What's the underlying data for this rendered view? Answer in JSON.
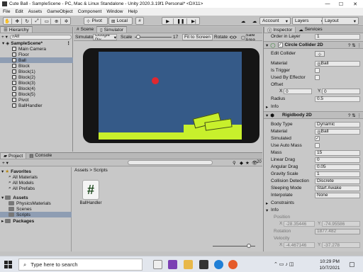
{
  "window": {
    "title": "Cute Ball - SampleScene - PC, Mac & Linux Standalone - Unity 2020.3.19f1 Personal* <DX11>",
    "min": "—",
    "max": "☐",
    "close": "✕"
  },
  "menu": [
    "File",
    "Edit",
    "Assets",
    "GameObject",
    "Component",
    "Window",
    "Help"
  ],
  "toolbar": {
    "pivot": "Pivot",
    "local": "Local",
    "account": "Account",
    "layers": "Layers",
    "layout": "Layout"
  },
  "hierarchy": {
    "tab": "Hierarchy",
    "search_placeholder": "All",
    "scene": "SampleScene*",
    "items": [
      "Main Camera",
      "Floor",
      "Ball",
      "Block",
      "Block(1)",
      "Block(2)",
      "Block(3)",
      "Block(4)",
      "Block(5)",
      "Pivot",
      "BallHandler"
    ],
    "selected": "Ball"
  },
  "scene_view": {
    "tab_scene": "Scene",
    "tab_sim": "Simulator",
    "device": "Simulator",
    "device_model": "Google Pix",
    "scale_label": "Scale",
    "scale_value": "17",
    "fit": "Fit to Screen",
    "rotate": "Rotate",
    "safe": "Safe Area"
  },
  "inspector": {
    "tab": "Inspector",
    "tab2": "Services",
    "order_label": "Order in Layer",
    "order_value": "1",
    "circle": {
      "title": "Circle Collider 2D",
      "edit": "Edit Collider",
      "material": "Material",
      "material_value": "Ball",
      "trigger": "Is Trigger",
      "effector": "Used By Effector",
      "offset": "Offset",
      "x": "0",
      "y": "0",
      "radius_label": "Radius",
      "radius": "0.5",
      "info": "Info"
    },
    "rb": {
      "title": "Rigidbody 2D",
      "bodytype": "Body Type",
      "bodytype_val": "Dynamic",
      "material": "Material",
      "material_val": "Ball",
      "simulated": "Simulated",
      "auto_mass": "Use Auto Mass",
      "mass": "Mass",
      "mass_val": "15",
      "linear": "Linear Drag",
      "linear_val": "0",
      "angular": "Angular Drag",
      "angular_val": "0.05",
      "gravity": "Gravity Scale",
      "gravity_val": "1",
      "collision": "Collision Detection",
      "collision_val": "Discrete",
      "sleeping": "Sleeping Mode",
      "sleeping_val": "Start Awake",
      "interp": "Interpolate",
      "interp_val": "None",
      "constraints": "Constraints",
      "info": "Info",
      "position": "Position",
      "pos_x": "-28.35446",
      "pos_y": "-74.95586",
      "rotation": "Rotation",
      "rotation_val": "1877.482",
      "velocity": "Velocity",
      "vel_x": "-4.467146",
      "vel_y": "-37.278"
    }
  },
  "project": {
    "tab": "Project",
    "tab2": "Console",
    "search_badge": "20",
    "breadcrumb": "Assets > Scripts",
    "favorites": "Favorites",
    "fav_items": [
      "All Materials",
      "All Models",
      "All Prefabs"
    ],
    "assets": "Assets",
    "asset_items": [
      "PhysicsMaterials",
      "Scenes",
      "Scripts"
    ],
    "packages": "Packages",
    "file_name": "BallHandler",
    "file_icon": "#"
  },
  "taskbar": {
    "search_placeholder": "Type here to search",
    "time": "10:29 PM",
    "date": "10/7/2021"
  },
  "colors": {
    "sky": "#355a88",
    "ground": "#c8f02c",
    "ball": "#e0282f",
    "selection": "#8e9db3"
  }
}
